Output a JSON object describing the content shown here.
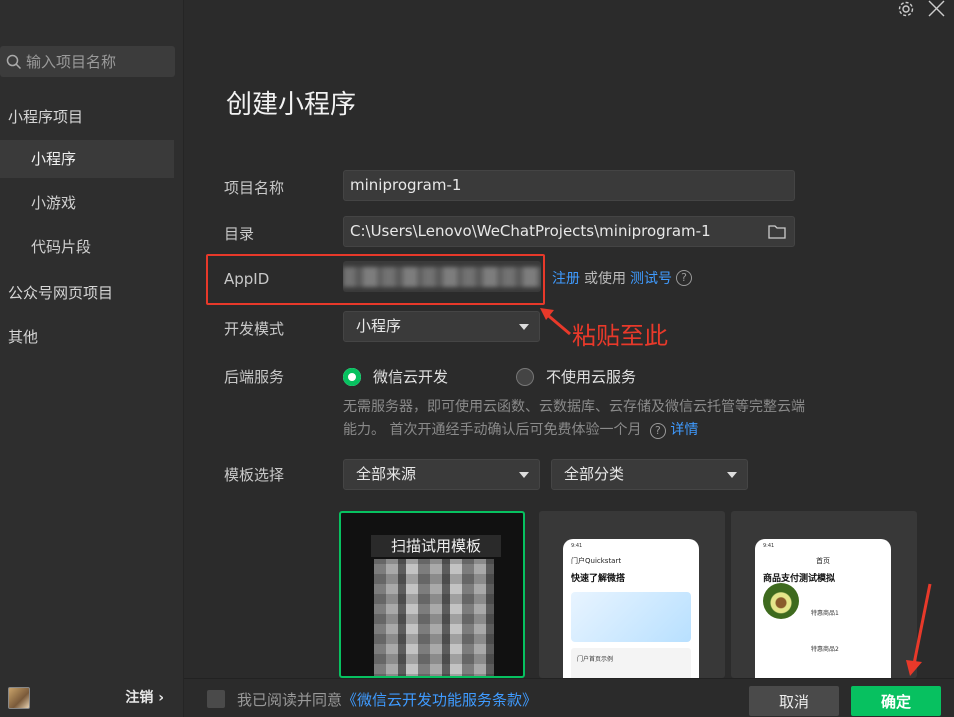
{
  "sidebar": {
    "search_placeholder": "输入项目名称",
    "groups": [
      "小程序项目",
      "公众号网页项目",
      "其他"
    ],
    "items": [
      "小程序",
      "小游戏",
      "代码片段"
    ],
    "logout": "注销 ›"
  },
  "page": {
    "title": "创建小程序"
  },
  "form": {
    "name_label": "项目名称",
    "name_value": "miniprogram-1",
    "dir_label": "目录",
    "dir_value": "C:\\Users\\Lenovo\\WeChatProjects\\miniprogram-1",
    "appid_label": "AppID",
    "register_link": "注册",
    "or_use": "或使用",
    "test_link": "测试号",
    "mode_label": "开发模式",
    "mode_value": "小程序",
    "backend_label": "后端服务",
    "backend_options": [
      "微信云开发",
      "不使用云服务"
    ],
    "backend_desc": "无需服务器，即可使用云函数、云数据库、云存储及微信云托管等完整云端能力。 首次开通经手动确认后可免费体验一个月",
    "backend_detail_link": "详情",
    "template_label": "模板选择",
    "template_source": "全部来源",
    "template_category": "全部分类"
  },
  "templates": {
    "scan_title": "扫描试用模板",
    "card2": {
      "time": "9:41",
      "app": "门户Quickstart",
      "title": "快速了解微搭",
      "item": "门户首页示例"
    },
    "card3": {
      "time": "9:41",
      "head": "首页",
      "title": "商品支付测试模拟",
      "item1": "特惠商品1",
      "item2": "特惠商品2"
    }
  },
  "annotation": {
    "paste_note": "粘贴至此"
  },
  "footer": {
    "agree_prefix": "我已阅读并同意",
    "agree_link": "《微信云开发功能服务条款》",
    "cancel": "取消",
    "confirm": "确定"
  },
  "colors": {
    "accent": "#07c160",
    "link": "#3f9bff",
    "annotation": "#e8392a"
  }
}
